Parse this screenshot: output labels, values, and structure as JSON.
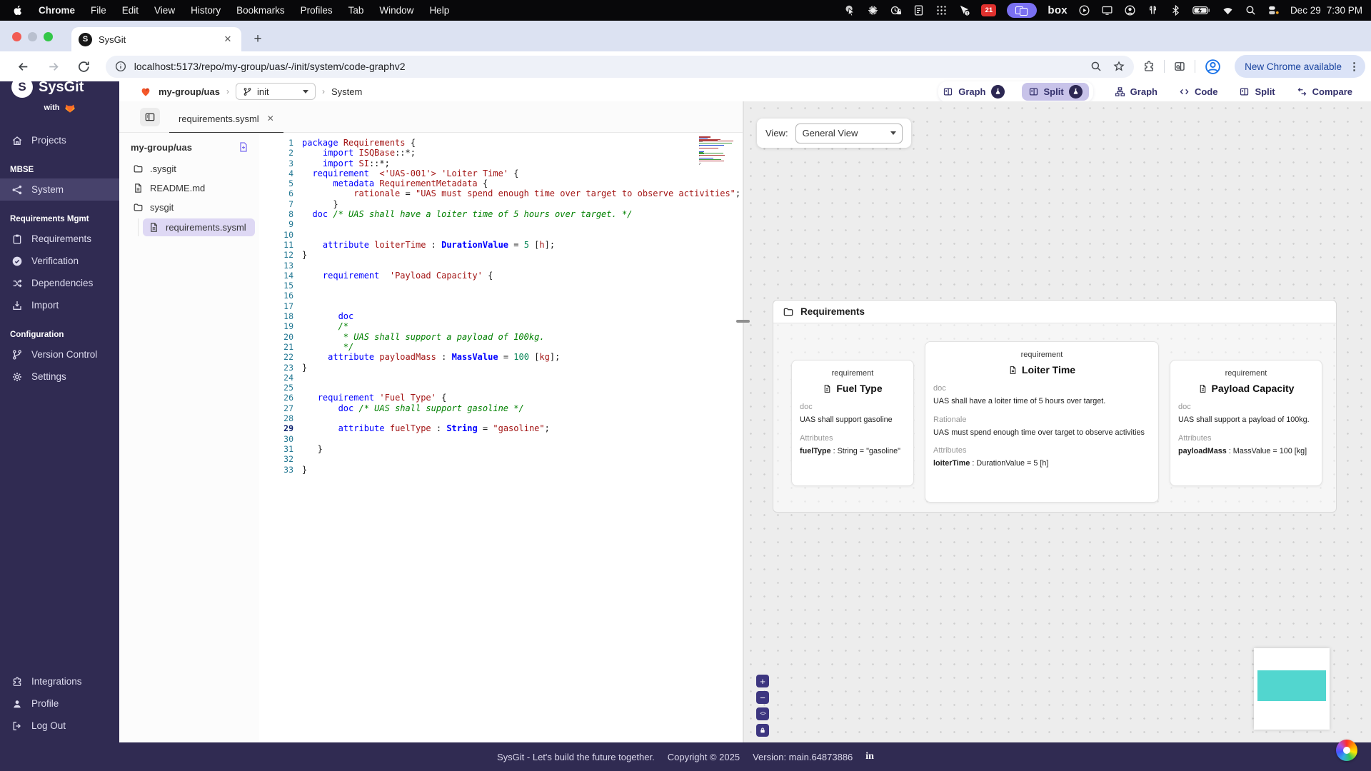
{
  "menubar": {
    "items": [
      "Chrome",
      "File",
      "Edit",
      "View",
      "History",
      "Bookmarks",
      "Profiles",
      "Tab",
      "Window",
      "Help"
    ],
    "bold_item": "Chrome",
    "status_icons": [
      "pointer",
      "burst",
      "timelock",
      "notes",
      "grid",
      "mouse-alert",
      "badge21",
      "screencopy",
      "boxtext",
      "play",
      "display",
      "person",
      "airpods",
      "bluetooth",
      "battery",
      "wifi",
      "search",
      "switcher"
    ],
    "badge21": "21",
    "box_label": "box",
    "date": "Dec 29",
    "time": "7:30 PM"
  },
  "browser": {
    "tab_title": "SysGit",
    "close_glyph": "✕",
    "new_tab_plus": "+",
    "url": "localhost:5173/repo/my-group/uas/-/init/system/code-graphv2",
    "update_button": "New Chrome available",
    "menu_dots": "⋮"
  },
  "breadcrumb": {
    "project": "my-group/uas",
    "sep1": "›",
    "branch": "init",
    "sep2": "›",
    "section": "System"
  },
  "toolbar": {
    "buttons": [
      {
        "label": "Graph",
        "icon": "splitpane",
        "beta": true,
        "active": false
      },
      {
        "label": "Split",
        "icon": "splitpane",
        "beta": true,
        "active": true
      },
      {
        "label": "Graph",
        "icon": "hierarchy",
        "beta": false,
        "active": false
      },
      {
        "label": "Code",
        "icon": "code",
        "beta": false,
        "active": false
      },
      {
        "label": "Split",
        "icon": "splitpane",
        "beta": false,
        "active": false
      },
      {
        "label": "Compare",
        "icon": "compare",
        "beta": false,
        "active": false
      }
    ]
  },
  "sidebar": {
    "logo_letter": "S",
    "logo_text": "SysGit",
    "with_label": "with",
    "sections": [
      {
        "header": "",
        "items": [
          {
            "label": "Projects",
            "icon": "home",
            "active": false
          }
        ]
      },
      {
        "header": "MBSE",
        "items": [
          {
            "label": "System",
            "icon": "system",
            "active": true
          }
        ]
      },
      {
        "header": "Requirements Mgmt",
        "items": [
          {
            "label": "Requirements",
            "icon": "clipboard",
            "active": false
          },
          {
            "label": "Verification",
            "icon": "check",
            "active": false
          },
          {
            "label": "Dependencies",
            "icon": "shuffle",
            "active": false
          },
          {
            "label": "Import",
            "icon": "import",
            "active": false
          }
        ]
      },
      {
        "header": "Configuration",
        "items": [
          {
            "label": "Version Control",
            "icon": "branch",
            "active": false
          },
          {
            "label": "Settings",
            "icon": "gear",
            "active": false
          }
        ]
      }
    ],
    "bottom_items": [
      {
        "label": "Integrations",
        "icon": "puzzle"
      },
      {
        "label": "Profile",
        "icon": "user"
      },
      {
        "label": "Log Out",
        "icon": "logout"
      }
    ]
  },
  "explorer": {
    "tab": "requirements.sysml",
    "tab_close": "✕",
    "root": "my-group/uas",
    "entries": [
      {
        "name": ".sysgit",
        "icon": "folder",
        "depth": 0,
        "selected": false
      },
      {
        "name": "README.md",
        "icon": "file",
        "depth": 0,
        "selected": false
      },
      {
        "name": "sysgit",
        "icon": "folder",
        "depth": 0,
        "selected": false
      },
      {
        "name": "requirements.sysml",
        "icon": "file",
        "depth": 1,
        "selected": true
      }
    ]
  },
  "editor": {
    "active_line": 29,
    "lines": [
      {
        "s": [
          [
            "package",
            "k"
          ],
          [
            " ",
            "p"
          ],
          [
            "Requirements",
            "r"
          ],
          [
            " {",
            "p"
          ]
        ]
      },
      {
        "s": [
          [
            "    ",
            "p"
          ],
          [
            "import",
            "k"
          ],
          [
            " ",
            "p"
          ],
          [
            "ISQBase",
            "r"
          ],
          [
            "::*;",
            "p"
          ]
        ]
      },
      {
        "s": [
          [
            "    ",
            "p"
          ],
          [
            "import",
            "k"
          ],
          [
            " ",
            "p"
          ],
          [
            "SI",
            "r"
          ],
          [
            "::*;",
            "p"
          ]
        ]
      },
      {
        "s": [
          [
            "  ",
            "p"
          ],
          [
            "requirement",
            "k"
          ],
          [
            "  ",
            "p"
          ],
          [
            "<'UAS-001'>",
            "r"
          ],
          [
            " ",
            "p"
          ],
          [
            "'Loiter Time'",
            "r"
          ],
          [
            " {",
            "p"
          ]
        ]
      },
      {
        "s": [
          [
            "      ",
            "p"
          ],
          [
            "metadata",
            "k"
          ],
          [
            " ",
            "p"
          ],
          [
            "RequirementMetadata",
            "r"
          ],
          [
            " {",
            "p"
          ]
        ]
      },
      {
        "s": [
          [
            "          ",
            "p"
          ],
          [
            "rationale",
            "r"
          ],
          [
            " = ",
            "p"
          ],
          [
            "\"UAS must spend enough time over target to observe activities\"",
            "s"
          ],
          [
            ";",
            "p"
          ]
        ]
      },
      {
        "s": [
          [
            "      }",
            "p"
          ]
        ]
      },
      {
        "s": [
          [
            "  ",
            "p"
          ],
          [
            "doc",
            "k"
          ],
          [
            " ",
            "p"
          ],
          [
            "/* UAS shall have a loiter time of 5 hours over target. */",
            "c"
          ]
        ]
      },
      {
        "s": []
      },
      {
        "s": []
      },
      {
        "s": [
          [
            "    ",
            "p"
          ],
          [
            "attribute",
            "k"
          ],
          [
            " ",
            "p"
          ],
          [
            "loiterTime",
            "r"
          ],
          [
            " : ",
            "p"
          ],
          [
            "DurationValue",
            "t"
          ],
          [
            " = ",
            "p"
          ],
          [
            "5",
            "n"
          ],
          [
            " [",
            "p"
          ],
          [
            "h",
            "r"
          ],
          [
            "];",
            "p"
          ]
        ]
      },
      {
        "s": [
          [
            "}",
            "p"
          ]
        ]
      },
      {
        "s": []
      },
      {
        "s": [
          [
            "    ",
            "p"
          ],
          [
            "requirement",
            "k"
          ],
          [
            "  ",
            "p"
          ],
          [
            "'Payload Capacity'",
            "r"
          ],
          [
            " {",
            "p"
          ]
        ]
      },
      {
        "s": []
      },
      {
        "s": []
      },
      {
        "s": []
      },
      {
        "s": [
          [
            "       ",
            "p"
          ],
          [
            "doc",
            "k"
          ]
        ]
      },
      {
        "s": [
          [
            "       ",
            "p"
          ],
          [
            "/*",
            "c"
          ]
        ]
      },
      {
        "s": [
          [
            "        ",
            "p"
          ],
          [
            "* UAS shall support a payload of 100kg.",
            "c"
          ]
        ]
      },
      {
        "s": [
          [
            "        ",
            "p"
          ],
          [
            "*/",
            "c"
          ]
        ]
      },
      {
        "s": [
          [
            "     ",
            "p"
          ],
          [
            "attribute",
            "k"
          ],
          [
            " ",
            "p"
          ],
          [
            "payloadMass",
            "r"
          ],
          [
            " : ",
            "p"
          ],
          [
            "MassValue",
            "t"
          ],
          [
            " = ",
            "p"
          ],
          [
            "100",
            "n"
          ],
          [
            " [",
            "p"
          ],
          [
            "kg",
            "r"
          ],
          [
            "];",
            "p"
          ]
        ]
      },
      {
        "s": [
          [
            "}",
            "p"
          ]
        ]
      },
      {
        "s": []
      },
      {
        "s": []
      },
      {
        "s": [
          [
            "   ",
            "p"
          ],
          [
            "requirement",
            "k"
          ],
          [
            " ",
            "p"
          ],
          [
            "'Fuel Type'",
            "r"
          ],
          [
            " {",
            "p"
          ]
        ]
      },
      {
        "s": [
          [
            "       ",
            "p"
          ],
          [
            "doc",
            "k"
          ],
          [
            " ",
            "p"
          ],
          [
            "/* UAS shall support gasoline */",
            "c"
          ]
        ]
      },
      {
        "s": []
      },
      {
        "s": [
          [
            "       ",
            "p"
          ],
          [
            "attribute",
            "k"
          ],
          [
            " ",
            "p"
          ],
          [
            "fuelType",
            "r"
          ],
          [
            " : ",
            "p"
          ],
          [
            "String",
            "t"
          ],
          [
            " = ",
            "p"
          ],
          [
            "\"gasoline\"",
            "s"
          ],
          [
            ";",
            "p"
          ]
        ]
      },
      {
        "s": []
      },
      {
        "s": [
          [
            "   }",
            "p"
          ]
        ]
      },
      {
        "s": []
      },
      {
        "s": [
          [
            "}",
            "p"
          ]
        ]
      }
    ]
  },
  "graph": {
    "view_label": "View:",
    "view_value": "General View",
    "container_title": "Requirements",
    "cards": [
      {
        "kind": "requirement",
        "name": "Fuel Type",
        "sections": [
          {
            "label": "doc",
            "text": "UAS shall support gasoline"
          },
          {
            "label": "Attributes",
            "bold": "fuelType",
            "rest": " : String = \"gasoline\""
          }
        ]
      },
      {
        "kind": "requirement",
        "name": "Loiter Time",
        "sections": [
          {
            "label": "doc",
            "text": "UAS shall have a loiter time of 5 hours over target."
          },
          {
            "label": "Rationale",
            "text": "UAS must spend enough time over target to observe activities"
          },
          {
            "label": "Attributes",
            "bold": "loiterTime",
            "rest": " : DurationValue = 5 [h]"
          }
        ]
      },
      {
        "kind": "requirement",
        "name": "Payload Capacity",
        "sections": [
          {
            "label": "doc",
            "text": "UAS shall support a payload of 100kg."
          },
          {
            "label": "Attributes",
            "bold": "payloadMass",
            "rest": " : MassValue = 100 [kg]"
          }
        ]
      }
    ],
    "controls": [
      {
        "name": "zoom-in",
        "glyph": "+"
      },
      {
        "name": "zoom-out",
        "glyph": "−"
      },
      {
        "name": "fit-view",
        "glyph": "<>"
      },
      {
        "name": "lock",
        "glyph": "lock"
      }
    ]
  },
  "footer": {
    "tagline": "SysGit - Let's build the future together.",
    "copyright": "Copyright © 2025",
    "version": "Version: main.64873886"
  }
}
